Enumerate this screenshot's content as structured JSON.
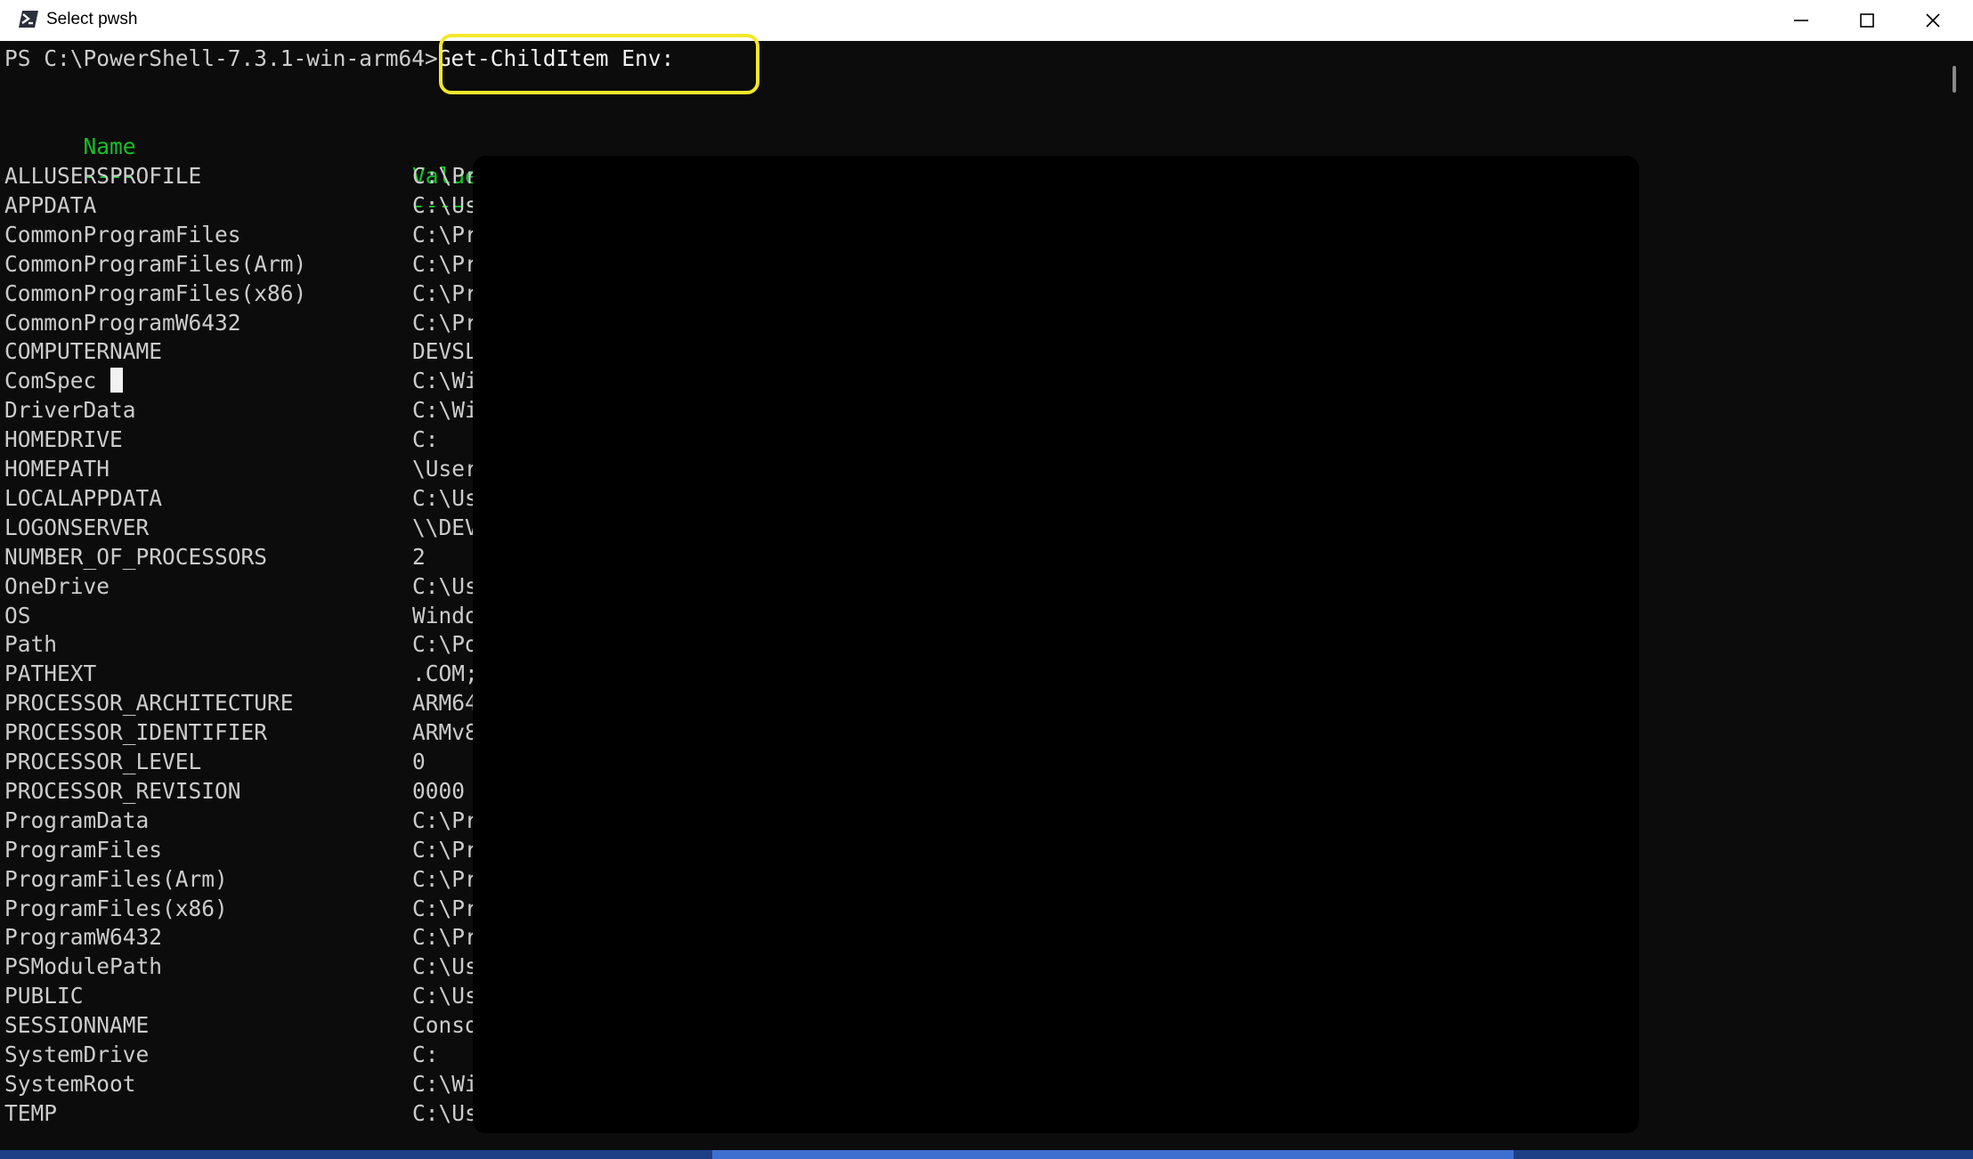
{
  "window": {
    "title": "Select pwsh",
    "icon": "powershell-icon",
    "controls": {
      "minimize": "minimize-icon",
      "maximize": "maximize-icon",
      "close": "close-icon"
    }
  },
  "prompt": {
    "path": "PS C:\\PowerShell-7.3.1-win-arm64>",
    "command": "Get-ChildItem Env:"
  },
  "table": {
    "headers": {
      "name": "Name",
      "value": "Value"
    },
    "separators": {
      "name": "----",
      "value": "-----"
    },
    "rows": [
      {
        "name": "ALLUSERSPROFILE",
        "value": "C:\\Pr"
      },
      {
        "name": "APPDATA",
        "value": "C:\\Us"
      },
      {
        "name": "CommonProgramFiles",
        "value": "C:\\Pr"
      },
      {
        "name": "CommonProgramFiles(Arm)",
        "value": "C:\\Pr"
      },
      {
        "name": "CommonProgramFiles(x86)",
        "value": "C:\\Pr"
      },
      {
        "name": "CommonProgramW6432",
        "value": "C:\\Pr"
      },
      {
        "name": "COMPUTERNAME",
        "value": "DEVSL"
      },
      {
        "name": "ComSpec",
        "value": "C:\\Wi"
      },
      {
        "name": "DriverData",
        "value": "C:\\Wi"
      },
      {
        "name": "HOMEDRIVE",
        "value": "C:"
      },
      {
        "name": "HOMEPATH",
        "value": "\\User"
      },
      {
        "name": "LOCALAPPDATA",
        "value": "C:\\Us"
      },
      {
        "name": "LOGONSERVER",
        "value": "\\\\DEV"
      },
      {
        "name": "NUMBER_OF_PROCESSORS",
        "value": "2"
      },
      {
        "name": "OneDrive",
        "value": "C:\\Us"
      },
      {
        "name": "OS",
        "value": "Windo"
      },
      {
        "name": "Path",
        "value": "C:\\Po"
      },
      {
        "name": "PATHEXT",
        "value": ".COM;"
      },
      {
        "name": "PROCESSOR_ARCHITECTURE",
        "value": "ARM64"
      },
      {
        "name": "PROCESSOR_IDENTIFIER",
        "value": "ARMv8"
      },
      {
        "name": "PROCESSOR_LEVEL",
        "value": "0"
      },
      {
        "name": "PROCESSOR_REVISION",
        "value": "0000"
      },
      {
        "name": "ProgramData",
        "value": "C:\\Pr"
      },
      {
        "name": "ProgramFiles",
        "value": "C:\\Pr"
      },
      {
        "name": "ProgramFiles(Arm)",
        "value": "C:\\Pr"
      },
      {
        "name": "ProgramFiles(x86)",
        "value": "C:\\Pr"
      },
      {
        "name": "ProgramW6432",
        "value": "C:\\Pr"
      },
      {
        "name": "PSModulePath",
        "value": "C:\\Us"
      },
      {
        "name": "PUBLIC",
        "value": "C:\\Us"
      },
      {
        "name": "SESSIONNAME",
        "value": "Conso"
      },
      {
        "name": "SystemDrive",
        "value": "C:"
      },
      {
        "name": "SystemRoot",
        "value": "C:\\Wi"
      },
      {
        "name": "TEMP",
        "value": "C:\\Us"
      }
    ]
  },
  "colors": {
    "terminal_bg": "#0c0c0c",
    "terminal_text": "#cccccc",
    "header_green": "#13c22a",
    "highlight_yellow": "#f5e72a"
  }
}
